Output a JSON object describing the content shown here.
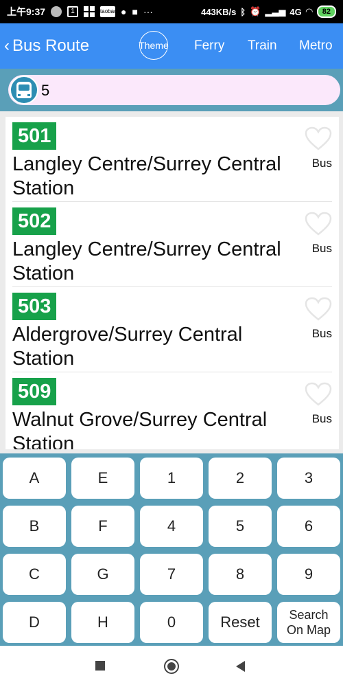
{
  "status_bar": {
    "time": "上午9:37",
    "network_speed": "443KB/s",
    "signal": "4G",
    "battery": "82"
  },
  "header": {
    "back_icon": "chevron-left-icon",
    "title": "Bus Route",
    "theme_label": "Theme",
    "nav": [
      "Ferry",
      "Train",
      "Metro"
    ]
  },
  "search": {
    "value": "5",
    "icon": "bus-icon"
  },
  "routes": [
    {
      "number": "501",
      "name": "Langley Centre/Surrey Central Station",
      "type": "Bus"
    },
    {
      "number": "502",
      "name": "Langley Centre/Surrey Central Station",
      "type": "Bus"
    },
    {
      "number": "503",
      "name": "Aldergrove/Surrey Central Station",
      "type": "Bus"
    },
    {
      "number": "509",
      "name": "Walnut Grove/Surrey Central Station",
      "type": "Bus"
    }
  ],
  "keypad": {
    "rows": [
      [
        "A",
        "E",
        "1",
        "2",
        "3"
      ],
      [
        "B",
        "F",
        "4",
        "5",
        "6"
      ],
      [
        "C",
        "G",
        "7",
        "8",
        "9"
      ],
      [
        "D",
        "H",
        "0",
        "Reset",
        "Search On Map"
      ]
    ]
  },
  "colors": {
    "appbar": "#3b8ef3",
    "route_badge": "#17a14a",
    "keypad_bg": "#5a9fb8",
    "search_bg": "#fbe8fb"
  }
}
